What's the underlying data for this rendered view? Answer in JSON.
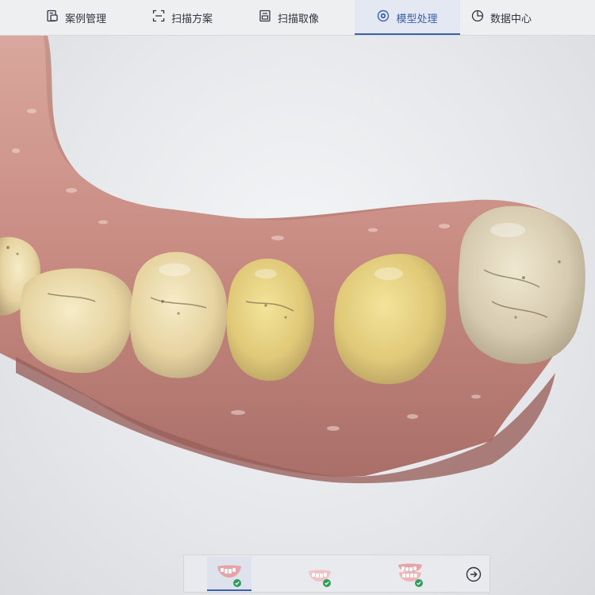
{
  "nav": {
    "items": [
      {
        "label": "案例管理",
        "icon": "case-management-icon"
      },
      {
        "label": "扫描方案",
        "icon": "scan-plan-icon"
      },
      {
        "label": "扫描取像",
        "icon": "scan-capture-icon"
      },
      {
        "label": "模型处理",
        "icon": "model-processing-icon"
      },
      {
        "label": "数据中心",
        "icon": "data-center-icon"
      }
    ],
    "active_index": 3
  },
  "jaw_selector": {
    "items": [
      {
        "icon": "upper-jaw-icon",
        "status": "complete"
      },
      {
        "icon": "lower-jaw-icon",
        "status": "complete"
      },
      {
        "icon": "bite-icon",
        "status": "complete"
      }
    ],
    "active_index": 0,
    "next_icon": "arrow-right-circle-icon"
  },
  "colors": {
    "accent": "#3a5fae",
    "check": "#2e9e5b",
    "gum": "#c98f86",
    "tooth": "#e8d8a8"
  }
}
